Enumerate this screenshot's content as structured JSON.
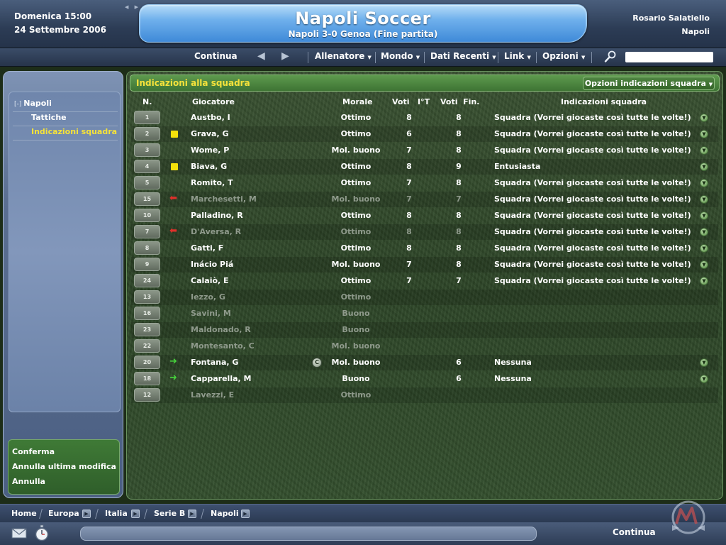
{
  "header": {
    "date_line1": "Domenica 15:00",
    "date_line2": "24 Settembre 2006",
    "title": "Napoli Soccer",
    "subtitle": "Napoli 3-0 Genoa (Fine partita)",
    "user_name": "Rosario Salatiello",
    "user_team": "Napoli"
  },
  "menu": {
    "continue": "Continua",
    "items": [
      "Allenatore",
      "Mondo",
      "Dati Recenti",
      "Link",
      "Opzioni"
    ],
    "search_placeholder": ""
  },
  "sidebar": {
    "toggle": "[-]",
    "root": "Napoli",
    "items": [
      {
        "label": "Tattiche",
        "active": false
      },
      {
        "label": "Indicazioni squadra",
        "active": true
      }
    ],
    "actions": [
      "Conferma",
      "Annulla ultima modifica",
      "Annulla"
    ]
  },
  "panel": {
    "title": "Indicazioni alla squadra",
    "options_button": "Opzioni indicazioni squadra"
  },
  "table": {
    "headers": {
      "num": "N.",
      "player": "Giocatore",
      "morale": "Morale",
      "v1": "Voti   I°T",
      "v2": "Voti  Fin.",
      "instr": "Indicazioni squadra"
    },
    "rows": [
      {
        "num": "1",
        "marker": "",
        "name": "Austbo, I",
        "captain": false,
        "morale": "Ottimo",
        "v1": "8",
        "v2": "8",
        "instr": "Squadra (Vorrei giocaste così tutte le volte!)",
        "dim": false,
        "dropdown": true
      },
      {
        "num": "2",
        "marker": "yellow",
        "name": "Grava, G",
        "captain": false,
        "morale": "Ottimo",
        "v1": "6",
        "v2": "8",
        "instr": "Squadra (Vorrei giocaste così tutte le volte!)",
        "dim": false,
        "dropdown": true
      },
      {
        "num": "3",
        "marker": "",
        "name": "Wome, P",
        "captain": false,
        "morale": "Mol. buono",
        "v1": "7",
        "v2": "8",
        "instr": "Squadra (Vorrei giocaste così tutte le volte!)",
        "dim": false,
        "dropdown": true
      },
      {
        "num": "4",
        "marker": "yellow",
        "name": "Biava, G",
        "captain": false,
        "morale": "Ottimo",
        "v1": "8",
        "v2": "9",
        "instr": "Entusiasta",
        "dim": false,
        "dropdown": true
      },
      {
        "num": "5",
        "marker": "",
        "name": "Romito, T",
        "captain": false,
        "morale": "Ottimo",
        "v1": "7",
        "v2": "8",
        "instr": "Squadra (Vorrei giocaste così tutte le volte!)",
        "dim": false,
        "dropdown": true
      },
      {
        "num": "15",
        "marker": "out",
        "name": "Marchesetti, M",
        "captain": false,
        "morale": "Mol. buono",
        "v1": "7",
        "v2": "7",
        "instr": "Squadra (Vorrei giocaste così tutte le volte!)",
        "dim": true,
        "dropdown": true
      },
      {
        "num": "10",
        "marker": "",
        "name": "Palladino, R",
        "captain": false,
        "morale": "Ottimo",
        "v1": "8",
        "v2": "8",
        "instr": "Squadra (Vorrei giocaste così tutte le volte!)",
        "dim": false,
        "dropdown": true
      },
      {
        "num": "7",
        "marker": "out",
        "name": "D'Aversa, R",
        "captain": false,
        "morale": "Ottimo",
        "v1": "8",
        "v2": "8",
        "instr": "Squadra (Vorrei giocaste così tutte le volte!)",
        "dim": true,
        "dropdown": true
      },
      {
        "num": "8",
        "marker": "",
        "name": "Gatti, F",
        "captain": false,
        "morale": "Ottimo",
        "v1": "8",
        "v2": "8",
        "instr": "Squadra (Vorrei giocaste così tutte le volte!)",
        "dim": false,
        "dropdown": true
      },
      {
        "num": "9",
        "marker": "",
        "name": "Inácio Piá",
        "captain": false,
        "morale": "Mol. buono",
        "v1": "7",
        "v2": "8",
        "instr": "Squadra (Vorrei giocaste così tutte le volte!)",
        "dim": false,
        "dropdown": true
      },
      {
        "num": "24",
        "marker": "",
        "name": "Calaiò, E",
        "captain": false,
        "morale": "Ottimo",
        "v1": "7",
        "v2": "7",
        "instr": "Squadra (Vorrei giocaste così tutte le volte!)",
        "dim": false,
        "dropdown": true
      },
      {
        "num": "13",
        "marker": "",
        "name": "Iezzo, G",
        "captain": false,
        "morale": "Ottimo",
        "v1": "",
        "v2": "",
        "instr": "",
        "dim": true,
        "dropdown": false
      },
      {
        "num": "16",
        "marker": "",
        "name": "Savini, M",
        "captain": false,
        "morale": "Buono",
        "v1": "",
        "v2": "",
        "instr": "",
        "dim": true,
        "dropdown": false
      },
      {
        "num": "23",
        "marker": "",
        "name": "Maldonado, R",
        "captain": false,
        "morale": "Buono",
        "v1": "",
        "v2": "",
        "instr": "",
        "dim": true,
        "dropdown": false
      },
      {
        "num": "22",
        "marker": "",
        "name": "Montesanto, C",
        "captain": false,
        "morale": "Mol. buono",
        "v1": "",
        "v2": "",
        "instr": "",
        "dim": true,
        "dropdown": false
      },
      {
        "num": "20",
        "marker": "in",
        "name": "Fontana, G",
        "captain": true,
        "morale": "Mol. buono",
        "v1": "",
        "v2": "6",
        "instr": "Nessuna",
        "dim": false,
        "dropdown": true
      },
      {
        "num": "18",
        "marker": "in",
        "name": "Capparella, M",
        "captain": false,
        "morale": "Buono",
        "v1": "",
        "v2": "6",
        "instr": "Nessuna",
        "dim": false,
        "dropdown": true
      },
      {
        "num": "12",
        "marker": "",
        "name": "Lavezzi, E",
        "captain": false,
        "morale": "Ottimo",
        "v1": "",
        "v2": "",
        "instr": "",
        "dim": true,
        "dropdown": false
      }
    ],
    "captain_letter": "C"
  },
  "breadcrumb": [
    "Home",
    "Europa",
    "Italia",
    "Serie B",
    "Napoli"
  ],
  "footer": {
    "continue": "Continua"
  },
  "colors": {
    "accent_yellow": "#f5e23a",
    "card_yellow": "#f4e10b",
    "sub_in": "#46d23c",
    "sub_out": "#e0302a"
  }
}
